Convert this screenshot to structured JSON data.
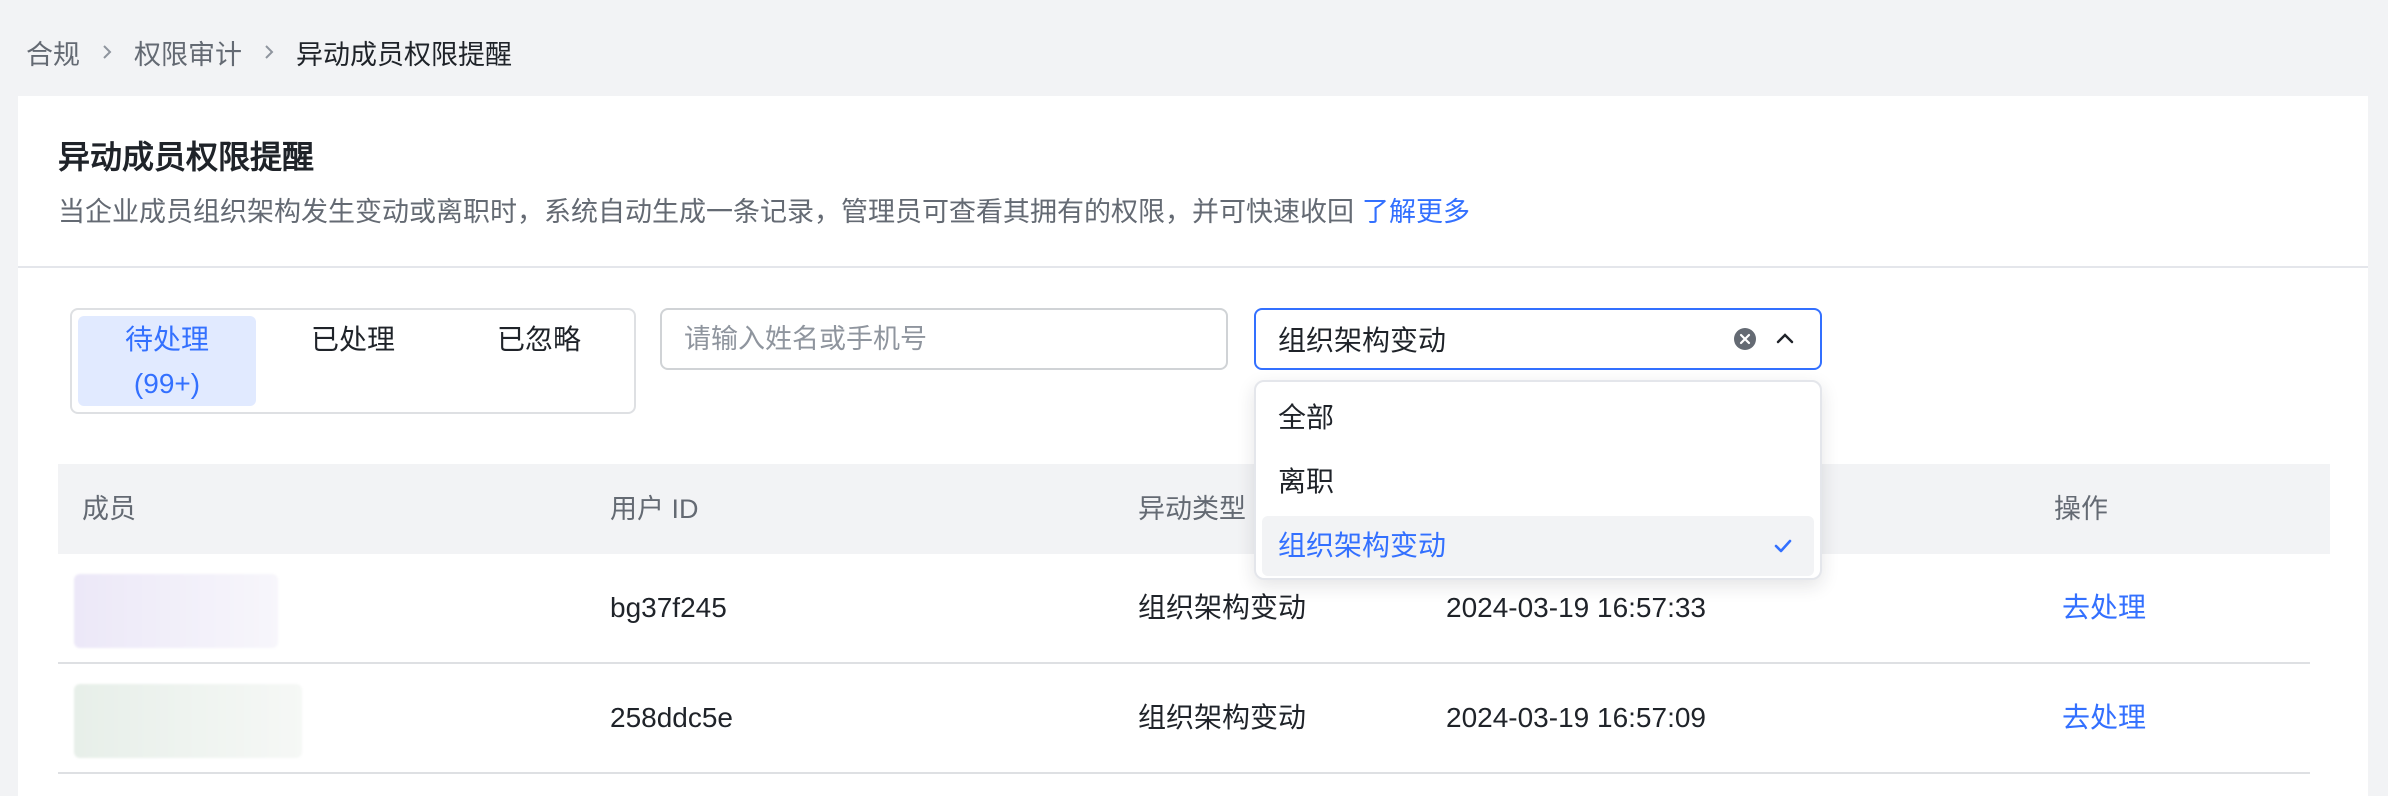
{
  "breadcrumb": {
    "items": [
      "合规",
      "权限审计",
      "异动成员权限提醒"
    ]
  },
  "page": {
    "title": "异动成员权限提醒",
    "description": "当企业成员组织架构发生变动或离职时，系统自动生成一条记录，管理员可查看其拥有的权限，并可快速收回",
    "learn_more": "了解更多"
  },
  "tabs": [
    {
      "label": "待处理",
      "count": "(99+)",
      "active": true
    },
    {
      "label": "已处理",
      "active": false
    },
    {
      "label": "已忽略",
      "active": false
    }
  ],
  "search": {
    "placeholder": "请输入姓名或手机号",
    "value": ""
  },
  "type_filter": {
    "selected": "组织架构变动",
    "options": [
      "全部",
      "离职",
      "组织架构变动"
    ]
  },
  "table": {
    "columns": [
      "成员",
      "用户 ID",
      "异动类型",
      "操作"
    ],
    "rows": [
      {
        "user_id": "bg37f245",
        "type": "组织架构变动",
        "time": "2024-03-19 16:57:33",
        "action": "去处理"
      },
      {
        "user_id": "258ddc5e",
        "type": "组织架构变动",
        "time": "2024-03-19 16:57:09",
        "action": "去处理"
      }
    ]
  },
  "colors": {
    "accent": "#3370ff",
    "accent_bg": "#e1eaff",
    "page_bg": "#f2f3f5",
    "text_primary": "#1f2329",
    "text_secondary": "#646a73"
  },
  "icons": [
    "chevron-right-icon",
    "clear-circle-icon",
    "chevron-up-icon",
    "check-icon"
  ]
}
